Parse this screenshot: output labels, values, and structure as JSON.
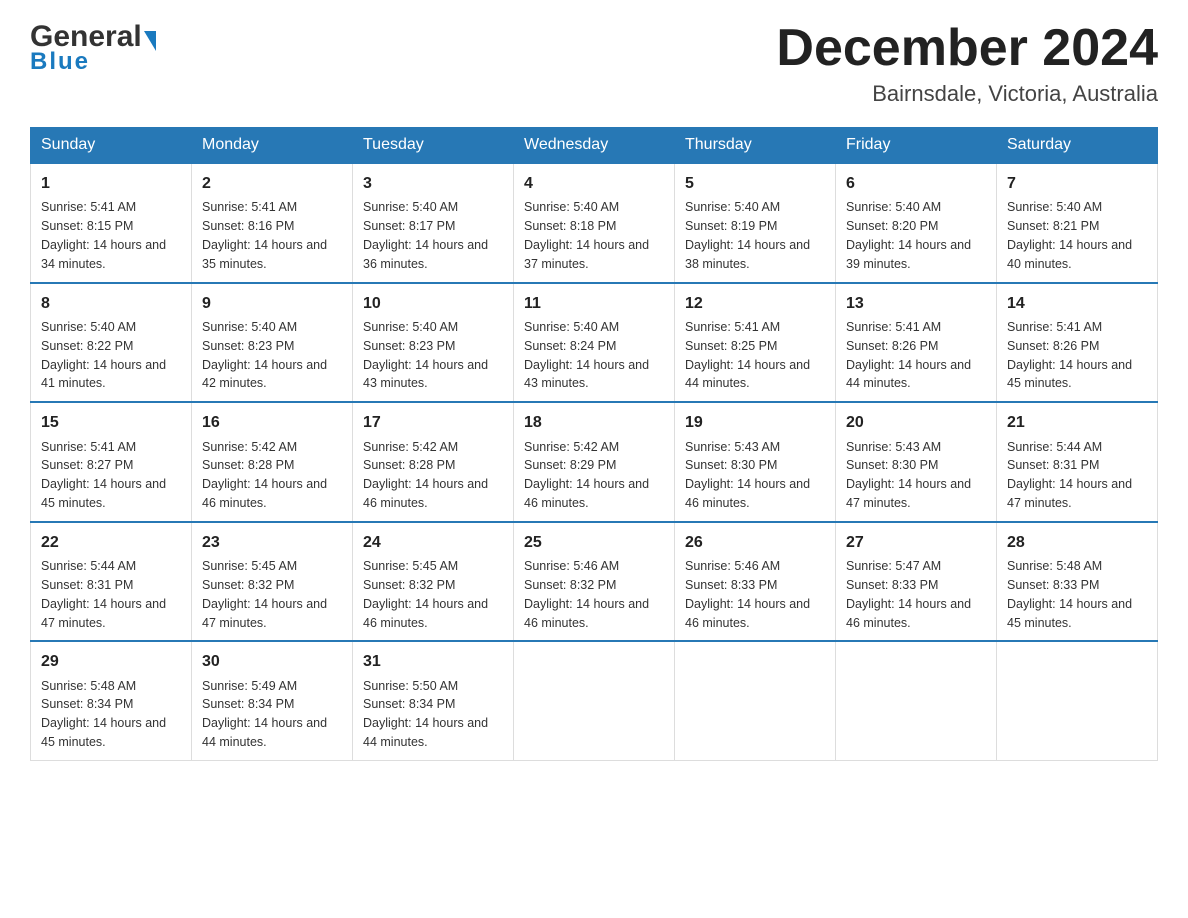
{
  "header": {
    "logo_general": "General",
    "logo_blue": "Blue",
    "month_title": "December 2024",
    "location": "Bairnsdale, Victoria, Australia"
  },
  "days_of_week": [
    "Sunday",
    "Monday",
    "Tuesday",
    "Wednesday",
    "Thursday",
    "Friday",
    "Saturday"
  ],
  "weeks": [
    [
      {
        "day": "1",
        "sunrise": "5:41 AM",
        "sunset": "8:15 PM",
        "daylight": "14 hours and 34 minutes."
      },
      {
        "day": "2",
        "sunrise": "5:41 AM",
        "sunset": "8:16 PM",
        "daylight": "14 hours and 35 minutes."
      },
      {
        "day": "3",
        "sunrise": "5:40 AM",
        "sunset": "8:17 PM",
        "daylight": "14 hours and 36 minutes."
      },
      {
        "day": "4",
        "sunrise": "5:40 AM",
        "sunset": "8:18 PM",
        "daylight": "14 hours and 37 minutes."
      },
      {
        "day": "5",
        "sunrise": "5:40 AM",
        "sunset": "8:19 PM",
        "daylight": "14 hours and 38 minutes."
      },
      {
        "day": "6",
        "sunrise": "5:40 AM",
        "sunset": "8:20 PM",
        "daylight": "14 hours and 39 minutes."
      },
      {
        "day": "7",
        "sunrise": "5:40 AM",
        "sunset": "8:21 PM",
        "daylight": "14 hours and 40 minutes."
      }
    ],
    [
      {
        "day": "8",
        "sunrise": "5:40 AM",
        "sunset": "8:22 PM",
        "daylight": "14 hours and 41 minutes."
      },
      {
        "day": "9",
        "sunrise": "5:40 AM",
        "sunset": "8:23 PM",
        "daylight": "14 hours and 42 minutes."
      },
      {
        "day": "10",
        "sunrise": "5:40 AM",
        "sunset": "8:23 PM",
        "daylight": "14 hours and 43 minutes."
      },
      {
        "day": "11",
        "sunrise": "5:40 AM",
        "sunset": "8:24 PM",
        "daylight": "14 hours and 43 minutes."
      },
      {
        "day": "12",
        "sunrise": "5:41 AM",
        "sunset": "8:25 PM",
        "daylight": "14 hours and 44 minutes."
      },
      {
        "day": "13",
        "sunrise": "5:41 AM",
        "sunset": "8:26 PM",
        "daylight": "14 hours and 44 minutes."
      },
      {
        "day": "14",
        "sunrise": "5:41 AM",
        "sunset": "8:26 PM",
        "daylight": "14 hours and 45 minutes."
      }
    ],
    [
      {
        "day": "15",
        "sunrise": "5:41 AM",
        "sunset": "8:27 PM",
        "daylight": "14 hours and 45 minutes."
      },
      {
        "day": "16",
        "sunrise": "5:42 AM",
        "sunset": "8:28 PM",
        "daylight": "14 hours and 46 minutes."
      },
      {
        "day": "17",
        "sunrise": "5:42 AM",
        "sunset": "8:28 PM",
        "daylight": "14 hours and 46 minutes."
      },
      {
        "day": "18",
        "sunrise": "5:42 AM",
        "sunset": "8:29 PM",
        "daylight": "14 hours and 46 minutes."
      },
      {
        "day": "19",
        "sunrise": "5:43 AM",
        "sunset": "8:30 PM",
        "daylight": "14 hours and 46 minutes."
      },
      {
        "day": "20",
        "sunrise": "5:43 AM",
        "sunset": "8:30 PM",
        "daylight": "14 hours and 47 minutes."
      },
      {
        "day": "21",
        "sunrise": "5:44 AM",
        "sunset": "8:31 PM",
        "daylight": "14 hours and 47 minutes."
      }
    ],
    [
      {
        "day": "22",
        "sunrise": "5:44 AM",
        "sunset": "8:31 PM",
        "daylight": "14 hours and 47 minutes."
      },
      {
        "day": "23",
        "sunrise": "5:45 AM",
        "sunset": "8:32 PM",
        "daylight": "14 hours and 47 minutes."
      },
      {
        "day": "24",
        "sunrise": "5:45 AM",
        "sunset": "8:32 PM",
        "daylight": "14 hours and 46 minutes."
      },
      {
        "day": "25",
        "sunrise": "5:46 AM",
        "sunset": "8:32 PM",
        "daylight": "14 hours and 46 minutes."
      },
      {
        "day": "26",
        "sunrise": "5:46 AM",
        "sunset": "8:33 PM",
        "daylight": "14 hours and 46 minutes."
      },
      {
        "day": "27",
        "sunrise": "5:47 AM",
        "sunset": "8:33 PM",
        "daylight": "14 hours and 46 minutes."
      },
      {
        "day": "28",
        "sunrise": "5:48 AM",
        "sunset": "8:33 PM",
        "daylight": "14 hours and 45 minutes."
      }
    ],
    [
      {
        "day": "29",
        "sunrise": "5:48 AM",
        "sunset": "8:34 PM",
        "daylight": "14 hours and 45 minutes."
      },
      {
        "day": "30",
        "sunrise": "5:49 AM",
        "sunset": "8:34 PM",
        "daylight": "14 hours and 44 minutes."
      },
      {
        "day": "31",
        "sunrise": "5:50 AM",
        "sunset": "8:34 PM",
        "daylight": "14 hours and 44 minutes."
      },
      null,
      null,
      null,
      null
    ]
  ],
  "labels": {
    "sunrise_prefix": "Sunrise: ",
    "sunset_prefix": "Sunset: ",
    "daylight_prefix": "Daylight: "
  }
}
